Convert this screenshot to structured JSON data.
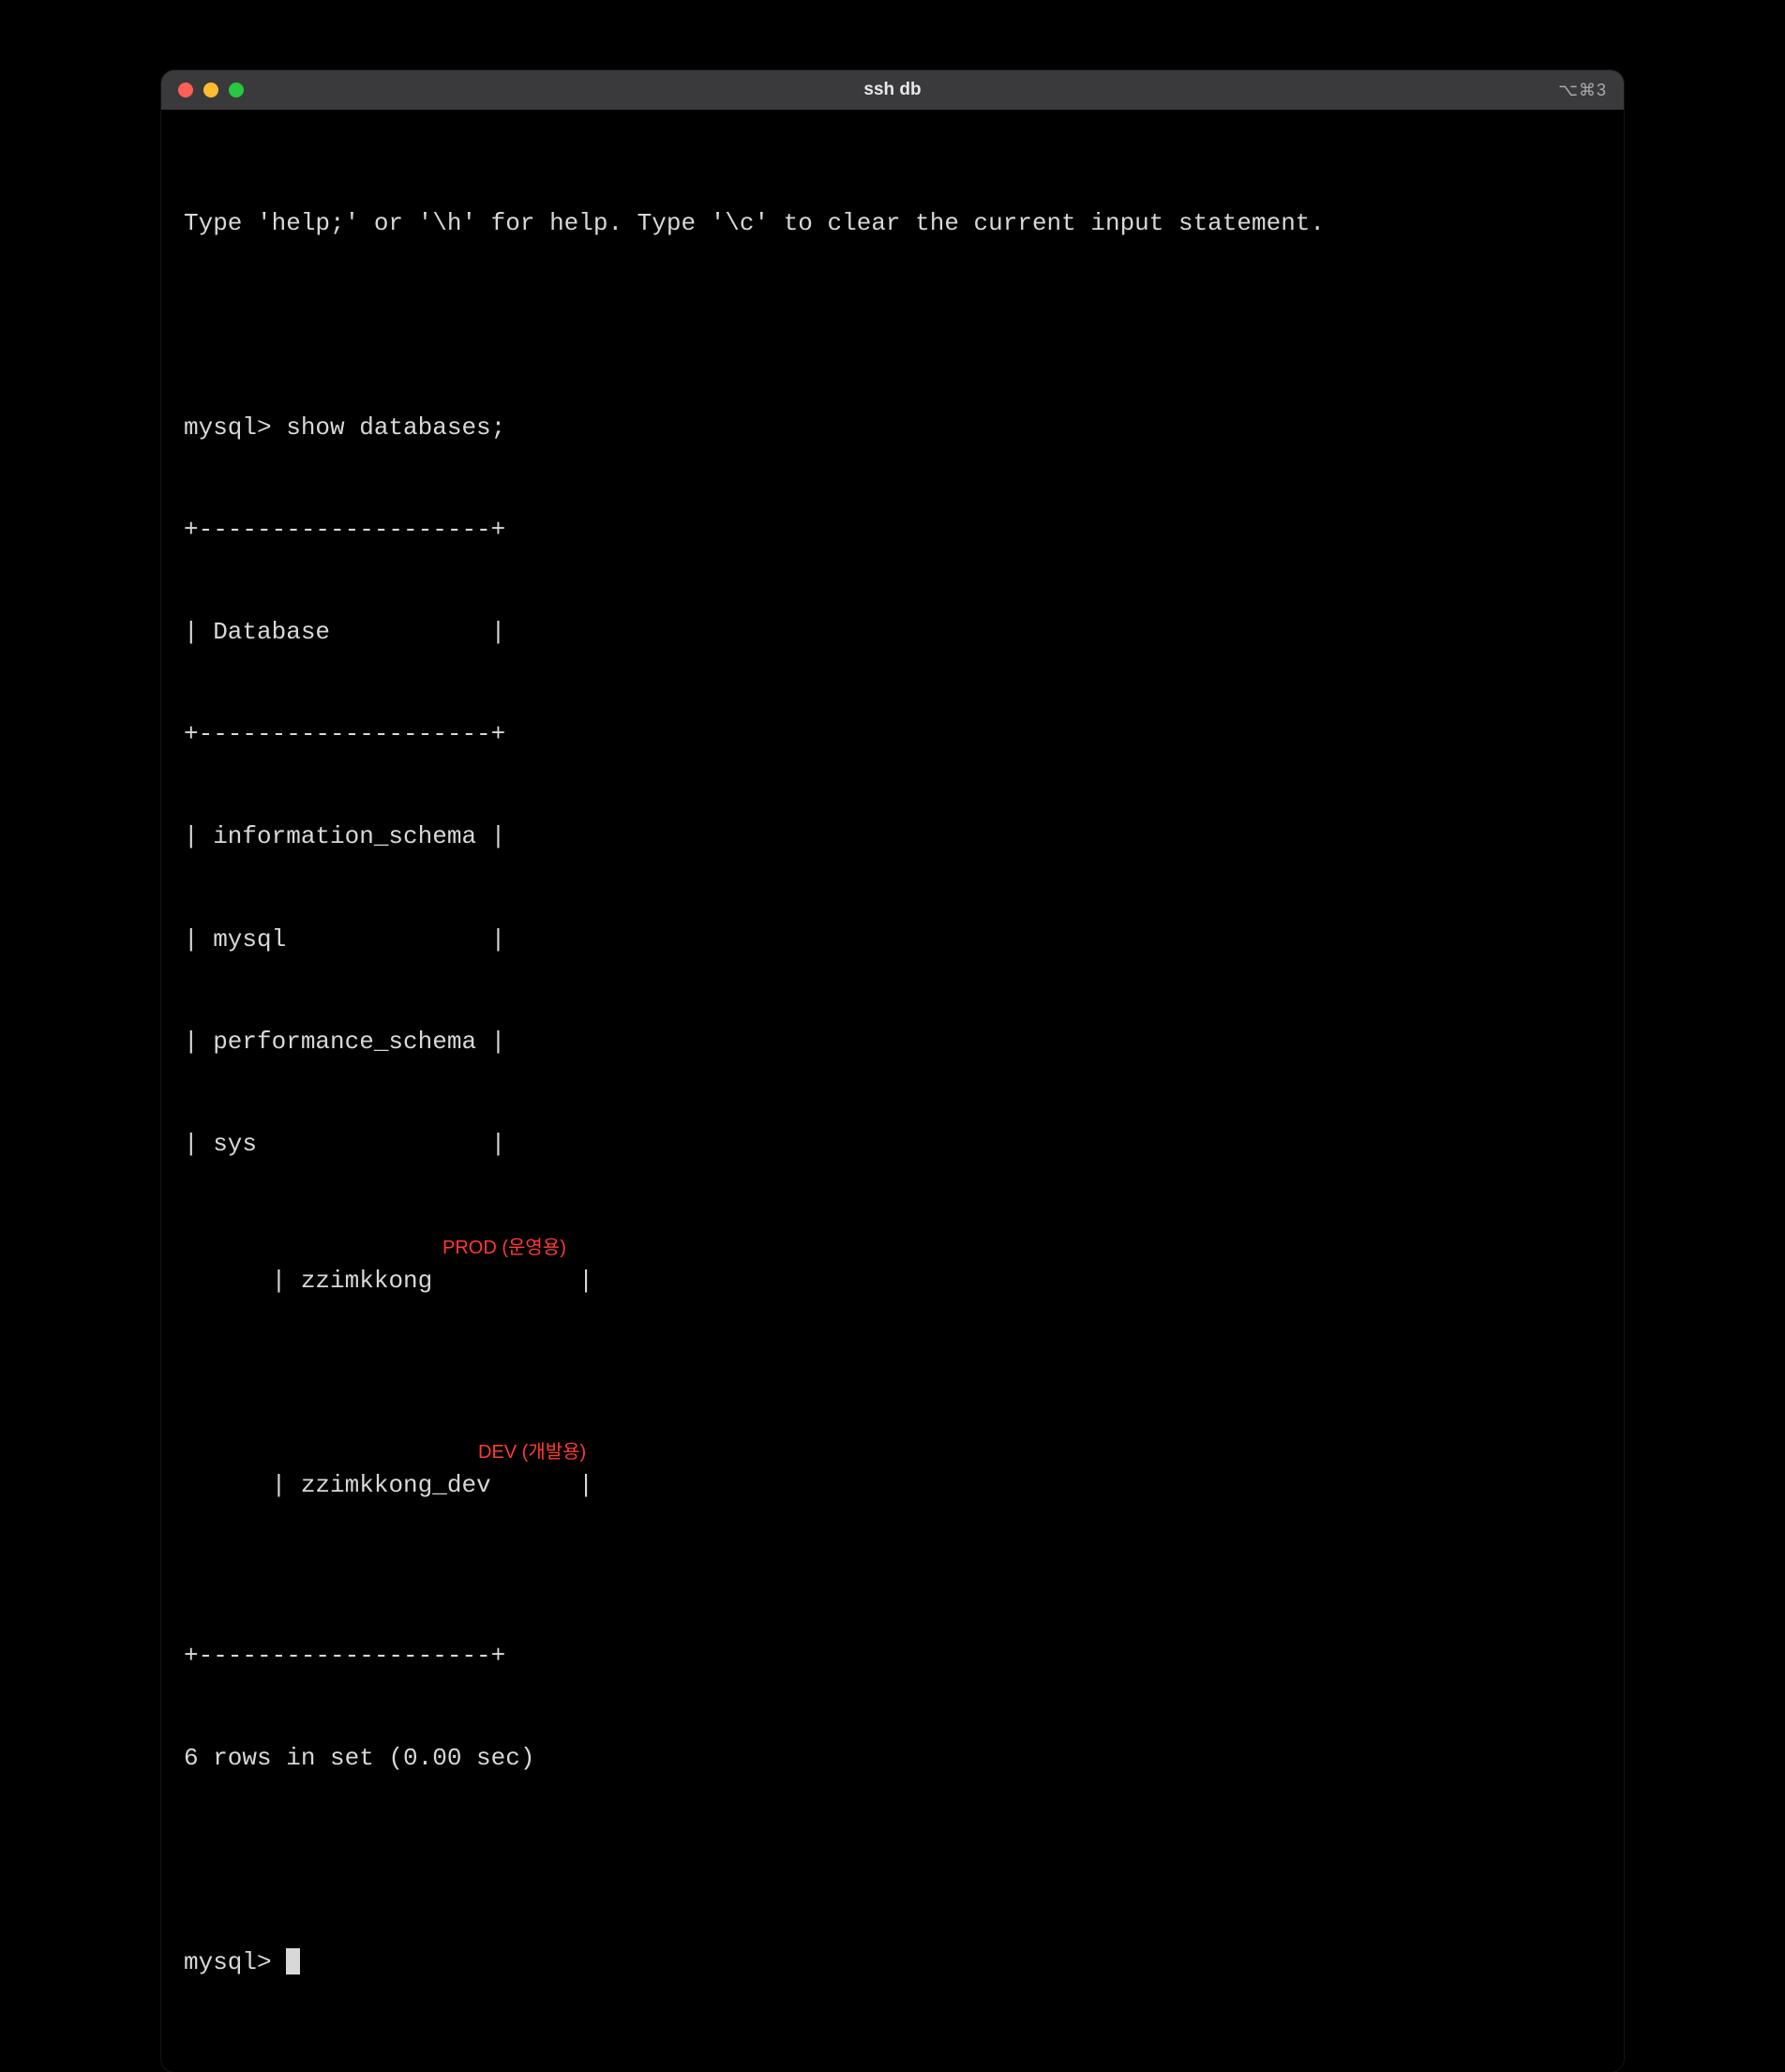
{
  "window": {
    "title": "ssh db",
    "indicator": "⌥⌘3"
  },
  "terminal": {
    "help_line": "Type 'help;' or '\\h' for help. Type '\\c' to clear the current input statement.",
    "blank1": "",
    "command_line": "mysql> show databases;",
    "border_top": "+--------------------+",
    "header_row": "| Database           |",
    "border_mid": "+--------------------+",
    "rows": [
      "| information_schema |",
      "| mysql              |",
      "| performance_schema |",
      "| sys                |",
      "| zzimkkong          |",
      "| zzimkkong_dev      |"
    ],
    "border_bottom": "+--------------------+",
    "result_line": "6 rows in set (0.00 sec)",
    "blank2": "",
    "prompt": "mysql> "
  },
  "annotations": {
    "prod": "PROD (운영용)",
    "dev": "DEV (개발용)"
  }
}
